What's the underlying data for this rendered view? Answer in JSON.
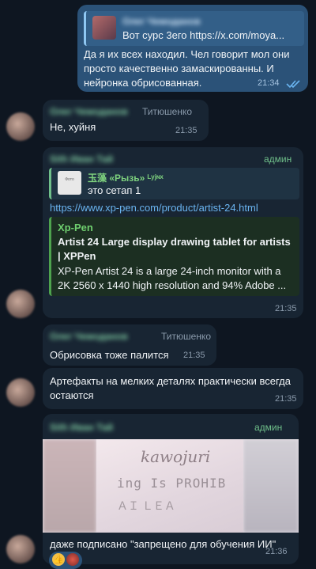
{
  "messages": {
    "m1": {
      "quote_sender": "Олег Чемоданов",
      "quote_text": "Вот сурс 3его https://x.com/moya...",
      "text_lines": [
        "Да я их всех находил. Чел говорит мол они",
        "просто качественно замаскированны. И",
        "нейронка обрисованная."
      ],
      "time": "21:34",
      "read_icon": "double-check-icon"
    },
    "m2": {
      "sender": "Олег Чемоданов",
      "role": "Титюшенко",
      "text": "Не, хуйня",
      "time": "21:35"
    },
    "m3": {
      "sender": "Sith Иван Тай",
      "role": "админ",
      "quote_sender": "玉藻 «Рызь» ᴸʸʲᶰˣ",
      "quote_text": "это сетап 1",
      "quote_thumb": "Фото",
      "link": "https://www.xp-pen.com/product/artist-24.html",
      "preview_site": "Xp-Pen",
      "preview_title_lines": [
        "Artist 24 Large display drawing tablet for artists",
        "| XPPen"
      ],
      "preview_desc_lines": [
        "XP-Pen Artist 24 is a large 24-inch monitor with a",
        "2K 2560 x 1440 high resolution and 94% Adobe ..."
      ],
      "time": "21:35"
    },
    "m4": {
      "sender": "Олег Чемоданов",
      "role": "Титюшенко",
      "text": "Обрисовка тоже палится",
      "time": "21:35"
    },
    "m5": {
      "text_lines": [
        "Артефакты на мелких деталях практически всегда",
        "остаются"
      ],
      "time": "21:35"
    },
    "m6": {
      "sender": "Sith Иван Тай",
      "role": "админ",
      "image_lines": [
        "kawojuri",
        "ing Is PROHIB",
        "ＡＩ ＬＥＡ"
      ],
      "caption": "даже подписано \"запрещено для обучения ИИ\"",
      "reaction_icon": "thumbs-up-icon",
      "time": "21:36"
    }
  },
  "colors": {
    "background": "#0e1621",
    "bubble_in": "#182533",
    "bubble_out": "#2b5278",
    "link": "#6ab4f0",
    "accent_green": "#6fbf8a"
  }
}
